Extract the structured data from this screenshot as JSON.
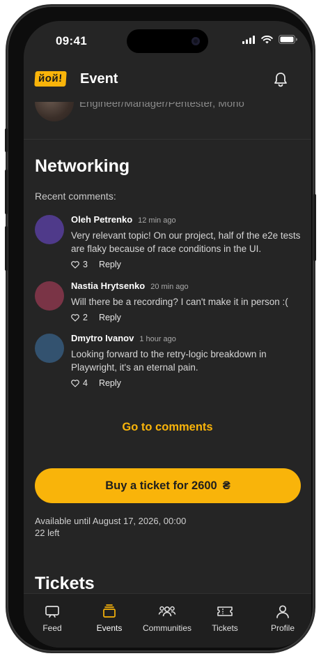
{
  "status_bar": {
    "time": "09:41"
  },
  "header": {
    "logo_text": "йой!",
    "title": "Event"
  },
  "speaker": {
    "role": "Engineer/Manager/Pentester, Mono"
  },
  "networking": {
    "title": "Networking",
    "recent_label": "Recent comments:",
    "comments": [
      {
        "name": "Oleh Petrenko",
        "time": "12 min ago",
        "text": "Very relevant topic! On our project, half of the e2e tests are flaky because of race conditions in the UI.",
        "likes": "3",
        "reply": "Reply",
        "avatar_color": "#4f3a8a"
      },
      {
        "name": "Nastia Hrytsenko",
        "time": "20 min ago",
        "text": "Will there be a recording? I can't make it in person :(",
        "likes": "2",
        "reply": "Reply",
        "avatar_color": "#7a3446"
      },
      {
        "name": "Dmytro Ivanov",
        "time": "1 hour ago",
        "text": "Looking forward to the retry-logic breakdown in Playwright, it's an eternal pain.",
        "likes": "4",
        "reply": "Reply",
        "avatar_color": "#33526f"
      }
    ],
    "go_to_comments": "Go to comments"
  },
  "purchase": {
    "button_label": "Buy a ticket for 2600",
    "currency_symbol": "₴",
    "available_until": "Available until August 17, 2026, 00:00",
    "left": "22 left"
  },
  "tickets_section": {
    "title": "Tickets"
  },
  "tabbar": {
    "items": [
      {
        "label": "Feed",
        "icon": "feed-icon"
      },
      {
        "label": "Events",
        "icon": "events-icon",
        "active": true
      },
      {
        "label": "Communities",
        "icon": "communities-icon"
      },
      {
        "label": "Tickets",
        "icon": "tickets-icon"
      },
      {
        "label": "Profile",
        "icon": "profile-icon"
      }
    ]
  },
  "colors": {
    "accent": "#f9b40a",
    "background": "#252525",
    "tabbar": "#1f1f1f"
  }
}
